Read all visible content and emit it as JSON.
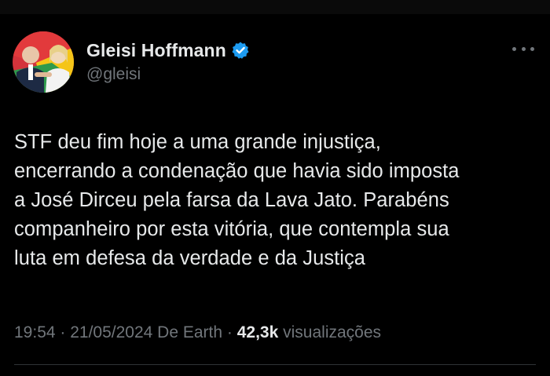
{
  "colors": {
    "background": "#000000",
    "primary_text": "#e7e9ea",
    "secondary_text": "#71767b",
    "verified": "#1d9bf0",
    "divider": "#2f3336"
  },
  "author": {
    "name": "Gleisi Hoffmann",
    "handle": "@gleisi",
    "verified_icon": "verified-badge-icon",
    "avatar_icon": "profile-avatar"
  },
  "tweet": {
    "text": "STF deu fim hoje a uma grande injustiça,\nencerrando a condenação que havia sido imposta\na José Dirceu pela farsa da Lava Jato. Parabéns\ncompanheiro por esta vitória, que contempla sua\nluta em defesa da verdade e da Justiça"
  },
  "meta": {
    "time": "19:54",
    "sep1": " · ",
    "date": "21/05/2024",
    "source": " De Earth",
    "sep2": " · ",
    "views_count": "42,3k",
    "views_label": " visualizações"
  },
  "more_icon": "more-horizontal-icon"
}
